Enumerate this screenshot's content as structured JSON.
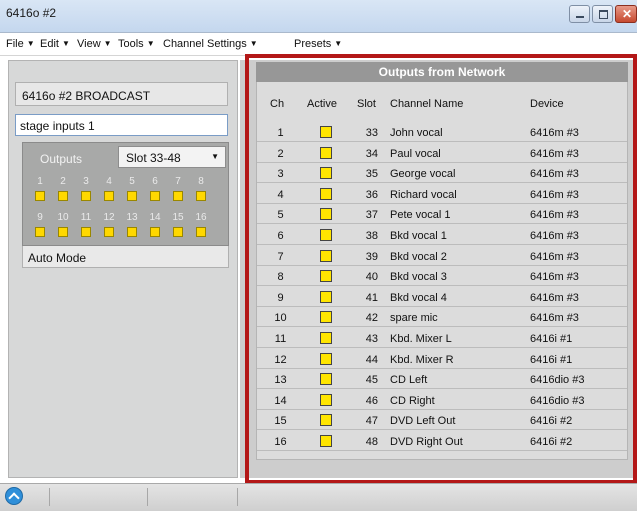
{
  "window": {
    "title": "6416o #2"
  },
  "menu": [
    "File",
    "Edit",
    "View",
    "Tools",
    "Channel Settings",
    "Presets"
  ],
  "left": {
    "device_name": "6416o #2 BROADCAST",
    "preset_name": "stage inputs 1",
    "outputs_label": "Outputs",
    "slot_selected": "Slot 33-48",
    "output_numbers": [
      "1",
      "2",
      "3",
      "4",
      "5",
      "6",
      "7",
      "8",
      "9",
      "10",
      "11",
      "12",
      "13",
      "14",
      "15",
      "16"
    ],
    "auto_mode_label": "Auto Mode"
  },
  "table": {
    "title": "Outputs from Network",
    "headers": {
      "ch": "Ch",
      "active": "Active",
      "slot": "Slot",
      "name": "Channel Name",
      "device": "Device"
    },
    "rows": [
      {
        "ch": "1",
        "slot": "33",
        "name": "John vocal",
        "device": "6416m #3"
      },
      {
        "ch": "2",
        "slot": "34",
        "name": "Paul vocal",
        "device": "6416m #3"
      },
      {
        "ch": "3",
        "slot": "35",
        "name": "George vocal",
        "device": "6416m #3"
      },
      {
        "ch": "4",
        "slot": "36",
        "name": "Richard vocal",
        "device": "6416m #3"
      },
      {
        "ch": "5",
        "slot": "37",
        "name": "Pete vocal 1",
        "device": "6416m #3"
      },
      {
        "ch": "6",
        "slot": "38",
        "name": "Bkd vocal 1",
        "device": "6416m #3"
      },
      {
        "ch": "7",
        "slot": "39",
        "name": "Bkd vocal 2",
        "device": "6416m #3"
      },
      {
        "ch": "8",
        "slot": "40",
        "name": "Bkd vocal 3",
        "device": "6416m #3"
      },
      {
        "ch": "9",
        "slot": "41",
        "name": "Bkd vocal 4",
        "device": "6416m #3"
      },
      {
        "ch": "10",
        "slot": "42",
        "name": "spare mic",
        "device": "6416m #3"
      },
      {
        "ch": "11",
        "slot": "43",
        "name": "Kbd. Mixer L",
        "device": "6416i #1"
      },
      {
        "ch": "12",
        "slot": "44",
        "name": "Kbd. Mixer R",
        "device": "6416i #1"
      },
      {
        "ch": "13",
        "slot": "45",
        "name": "CD Left",
        "device": "6416dio #3"
      },
      {
        "ch": "14",
        "slot": "46",
        "name": "CD Right",
        "device": "6416dio #3"
      },
      {
        "ch": "15",
        "slot": "47",
        "name": "DVD Left Out",
        "device": "6416i #2"
      },
      {
        "ch": "16",
        "slot": "48",
        "name": "DVD Right Out",
        "device": "6416i #2"
      }
    ]
  },
  "colors": {
    "highlight_frame": "#b31717",
    "active_indicator": "#ffe500",
    "table_title_bg": "#979797"
  }
}
